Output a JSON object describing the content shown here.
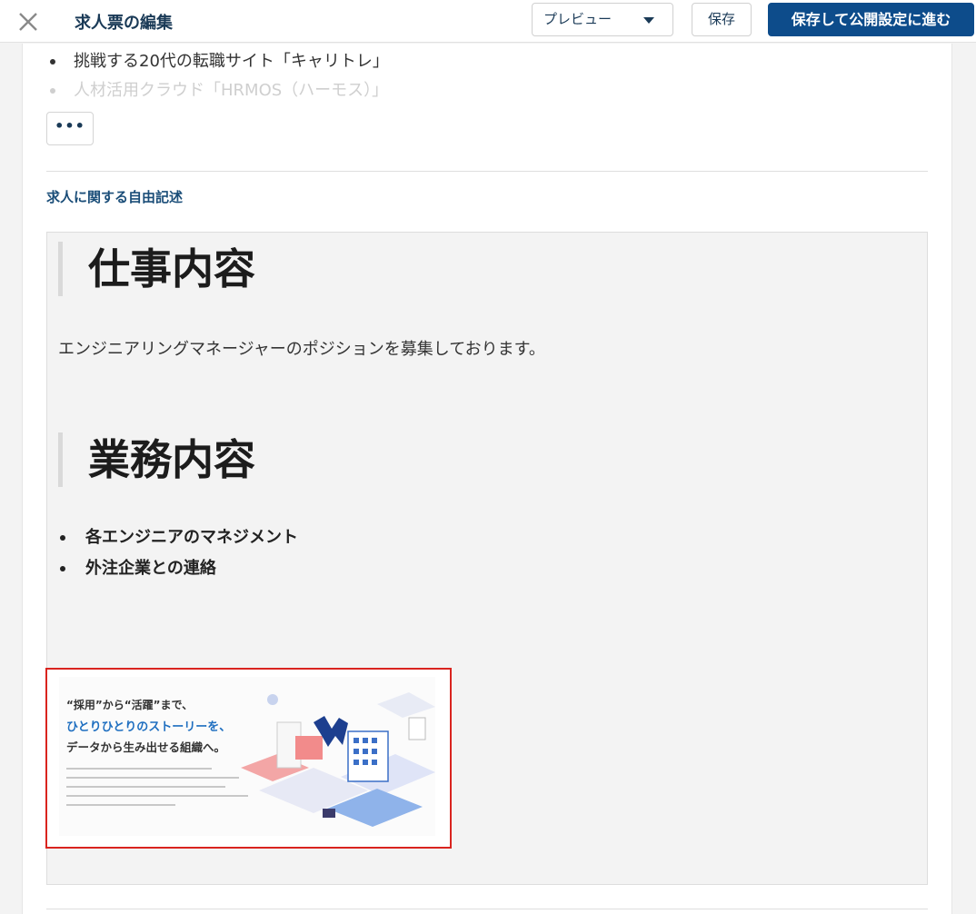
{
  "header": {
    "title": "求人票の編集",
    "preview_label": "プレビュー",
    "save_label": "保存",
    "publish_label": "保存して公開設定に進む"
  },
  "top_list": {
    "items": [
      "挑戦する20代の転職サイト「キャリトレ」",
      "人材活用クラウド「HRMOS（ハーモス）」"
    ]
  },
  "more_button": "•••",
  "section_label": "求人に関する自由記述",
  "editor": {
    "heading1": "仕事内容",
    "paragraph": "エンジニアリングマネージャーのポジションを募集しております。",
    "heading2": "業務内容",
    "bullets": [
      "各エンジニアのマネジメント",
      "外注企業との連絡"
    ],
    "image": {
      "line1": "“採用”から“活躍”まで、",
      "line2": "ひとりひとりのストーリーを、",
      "line3": "データから生み出せる組織へ。"
    }
  }
}
